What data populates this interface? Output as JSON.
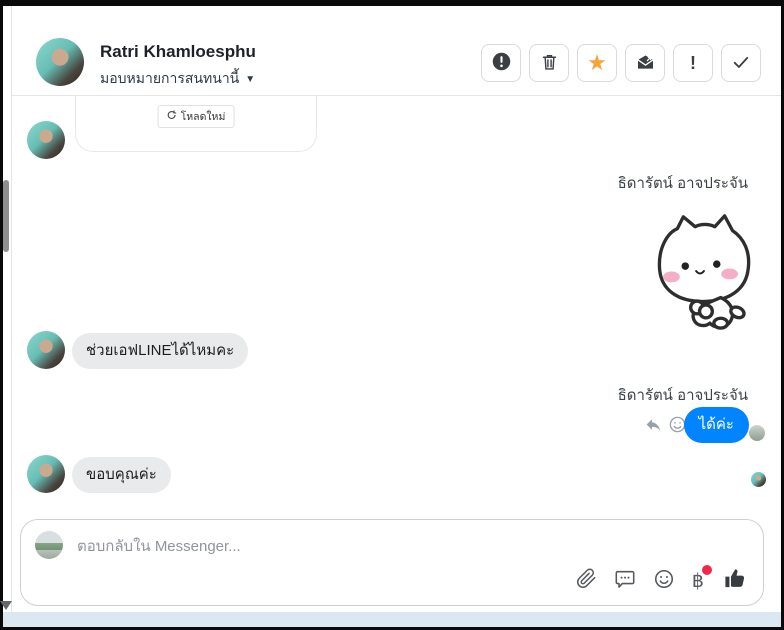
{
  "header": {
    "contact_name": "Ratri Khamloesphu",
    "assign_label": "มอบหมายการสนทนานี้",
    "toolbar": {
      "report": "report-conversation",
      "delete": "delete-conversation",
      "follow_up": "mark-follow-up",
      "mark_unread": "mark-as-unread",
      "mark_spam": "mark-as-spam",
      "mark_done": "mark-as-done"
    }
  },
  "icons": {
    "caret": "▼",
    "star": "★",
    "exclamation": "!",
    "baht": "฿"
  },
  "conversation": {
    "reload_label": "โหลดใหม่",
    "agent_name": "ธิดารัตน์ อาจประจัน",
    "sticker": "white-cat-pleading-sticker",
    "messages": [
      {
        "from": "customer",
        "text": "ช่วยเอฟLINEได้ไหมคะ"
      },
      {
        "from": "agent",
        "text": "ได้ค่ะ"
      },
      {
        "from": "customer",
        "text": "ขอบคุณค่ะ"
      }
    ]
  },
  "composer": {
    "placeholder": "ตอบกลับใน Messenger...",
    "icons": [
      "attach-file",
      "saved-replies",
      "emoji",
      "payment",
      "like"
    ]
  },
  "colors": {
    "accent_blue": "#0084FF",
    "star_orange": "#F5A33C",
    "badge_red": "#F02849",
    "bubble_gray": "#E9EAEB",
    "bottom_strip": "#DBE7F1"
  }
}
